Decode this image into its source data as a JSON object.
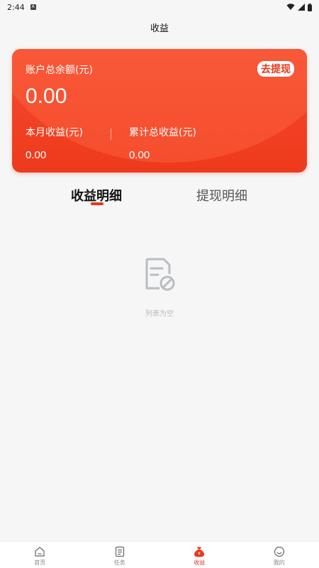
{
  "status": {
    "time": "2:44",
    "a_badge": "A"
  },
  "title": "收益",
  "card": {
    "balance_label": "账户总余额(元)",
    "balance_value": "0.00",
    "withdraw_label": "去提现",
    "month_label": "本月收益(元)",
    "month_value": "0.00",
    "total_label": "累计总收益(元)",
    "total_value": "0.00"
  },
  "tabs": {
    "income": "收益明细",
    "withdraw": "提现明细"
  },
  "empty": {
    "text": "列表为空",
    "icon": "empty-list-icon"
  },
  "nav": {
    "items": [
      {
        "label": "首页",
        "icon": "home-icon"
      },
      {
        "label": "任务",
        "icon": "task-icon"
      },
      {
        "label": "收益",
        "icon": "money-bag-icon"
      },
      {
        "label": "我的",
        "icon": "profile-icon"
      }
    ],
    "active_index": 2
  },
  "colors": {
    "accent": "#e8391b",
    "card_start": "#f44a30",
    "card_end": "#ee3a1c",
    "background": "#f6f6f6"
  }
}
